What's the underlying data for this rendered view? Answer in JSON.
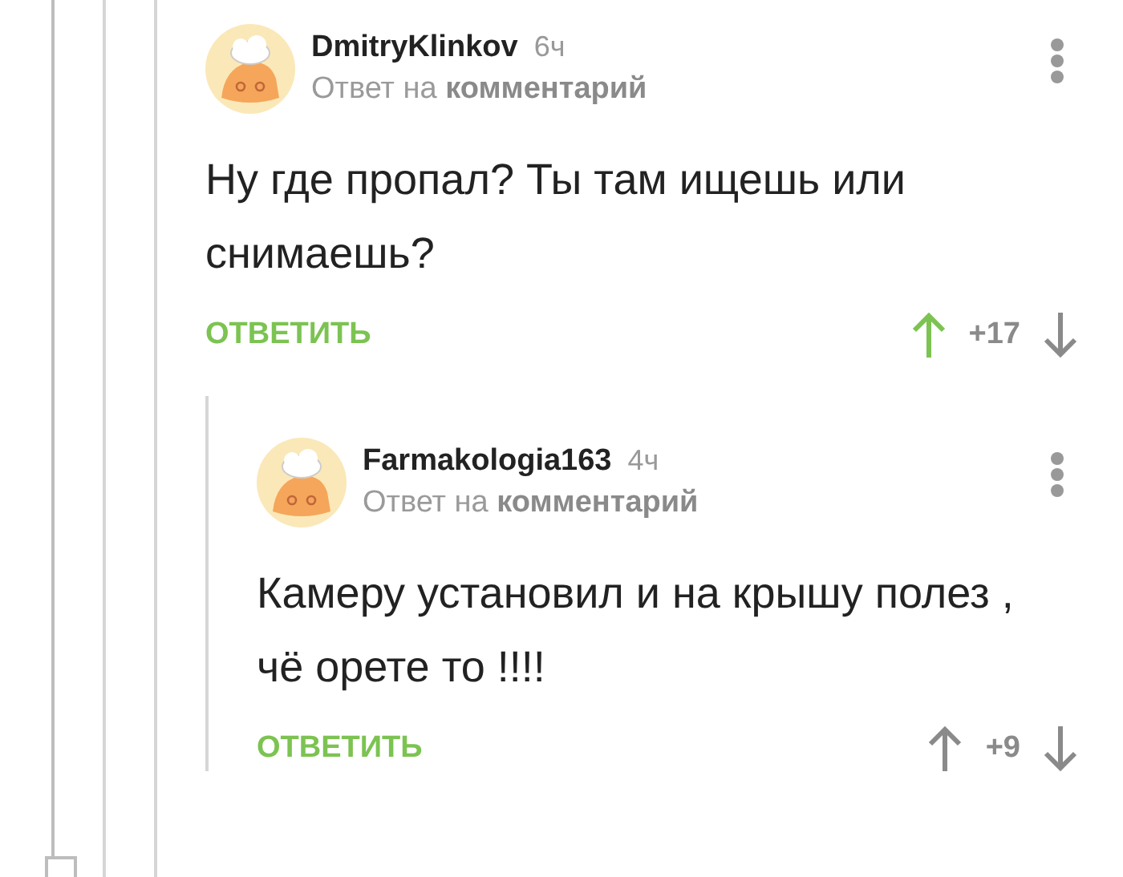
{
  "comments": [
    {
      "author": "DmitryKlinkov",
      "time": "6ч",
      "reply_to": "Ответ на **комментарий**",
      "body": "Ну где пропал? Ты там ищешь или снимаешь?",
      "reply_label": "ОТВЕТИТЬ",
      "rating": "+17",
      "upvoted": true,
      "children": [
        {
          "author": "Farmakologia163",
          "time": "4ч",
          "reply_to": "Ответ на **комментарий**",
          "body": "Камеру установил и на крышу полез , чё орете то !!!!",
          "reply_label": "ОТВЕТИТЬ",
          "rating": "+9",
          "upvoted": false
        }
      ]
    }
  ]
}
